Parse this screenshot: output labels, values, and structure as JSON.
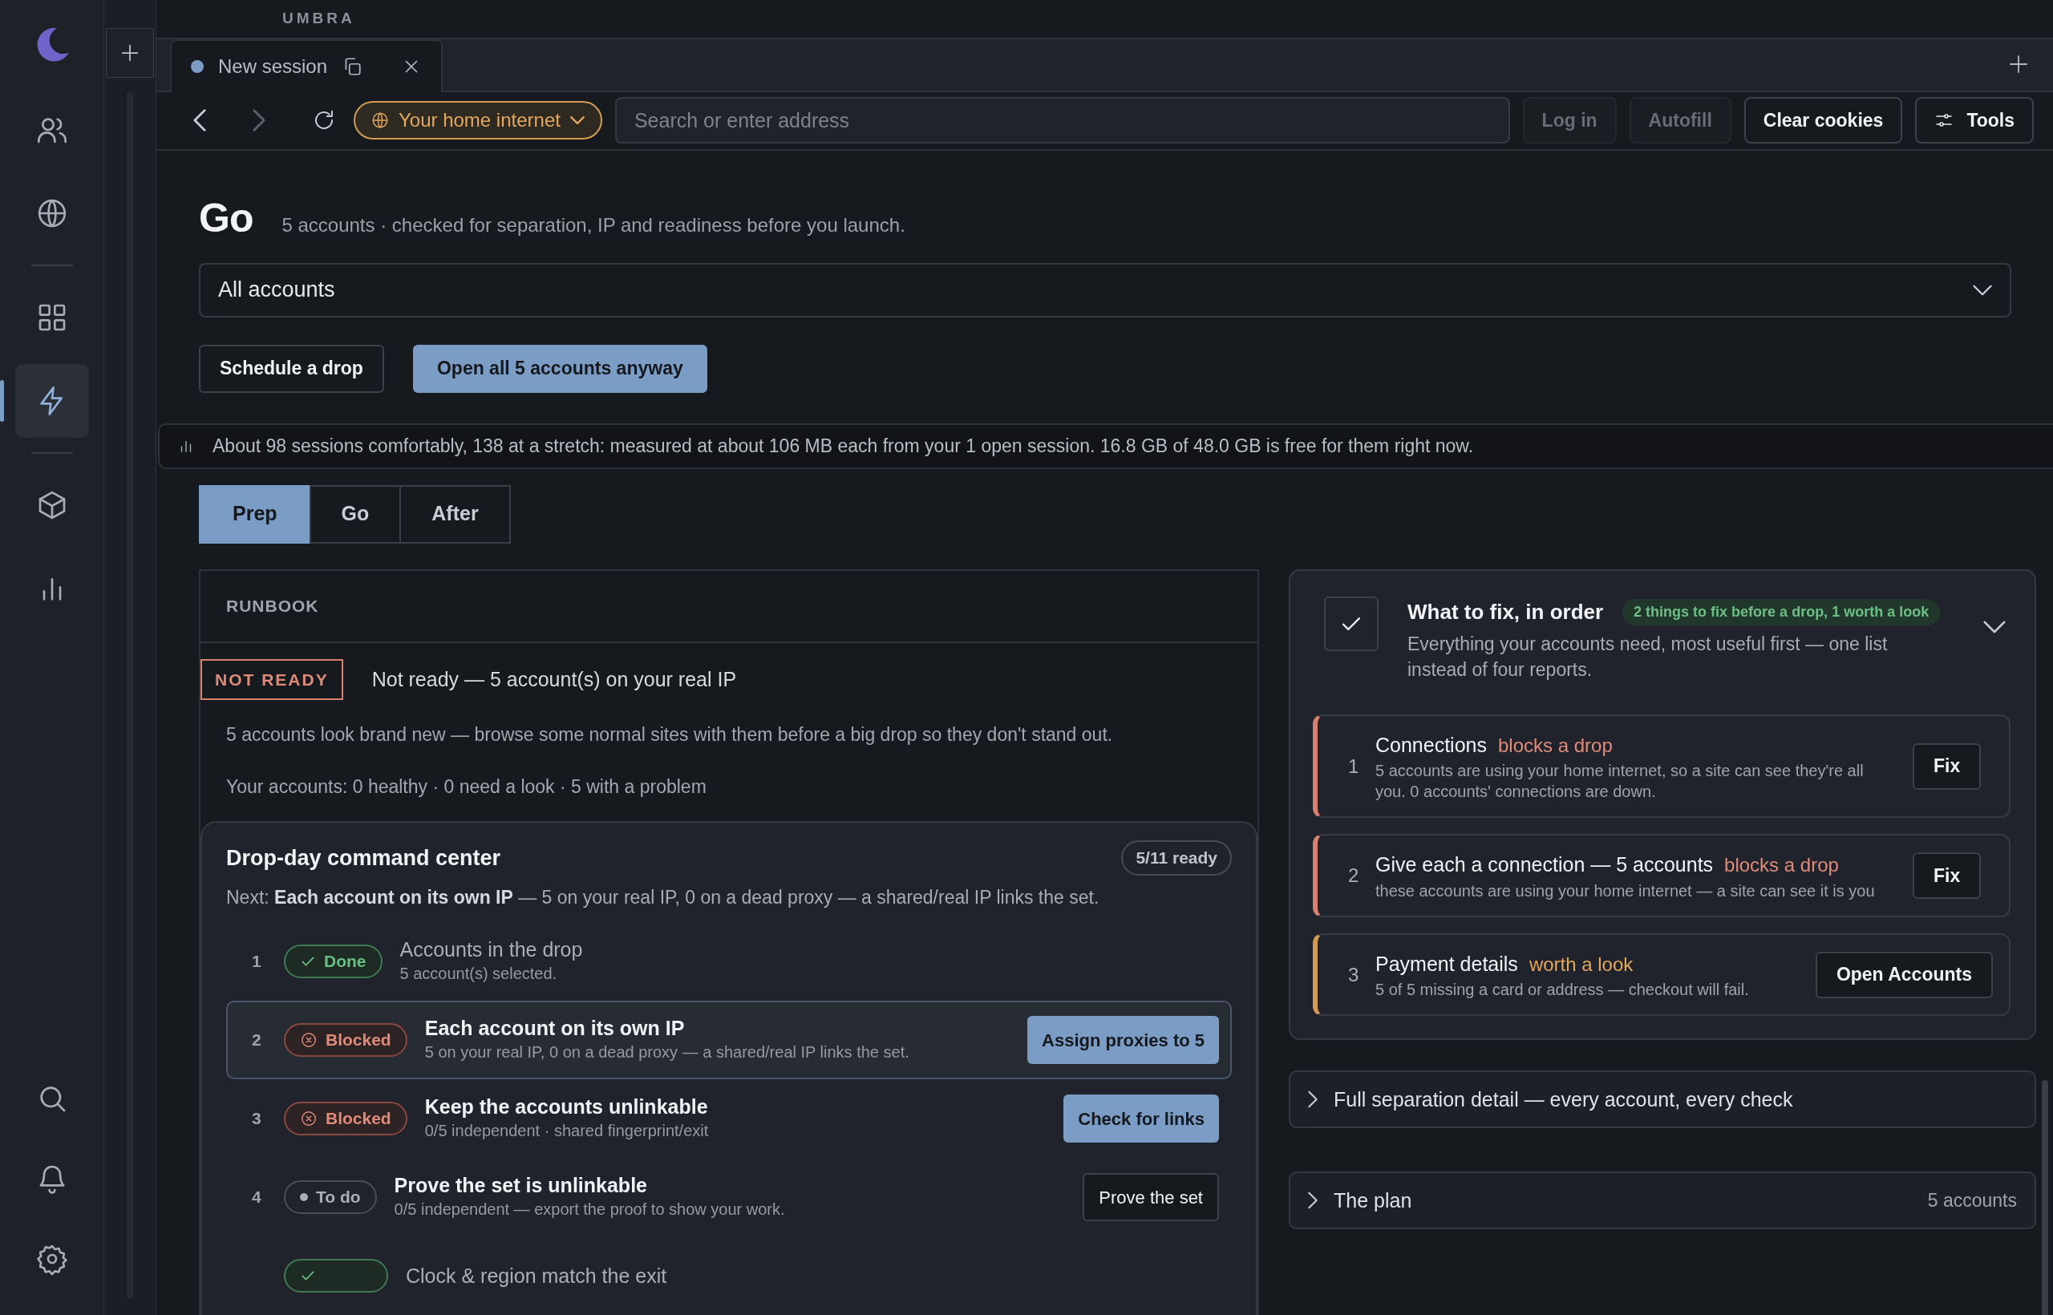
{
  "rail": {
    "items": [
      {
        "selected": false
      },
      {
        "selected": false
      },
      {
        "selected": false
      },
      {
        "selected": true
      },
      {
        "selected": false
      },
      {
        "selected": false
      }
    ]
  },
  "brand": "UMBRA",
  "tabs": [
    {
      "label": "New session",
      "selected": true,
      "color": "#7b9cc4"
    }
  ],
  "toolbar": {
    "forward_disabled": true,
    "proxy": "Your home internet",
    "address_placeholder": "Search or enter address",
    "buttons": [
      {
        "label": "Log in",
        "disabled": true
      },
      {
        "label": "Autofill",
        "disabled": true
      },
      {
        "label": "Clear cookies",
        "disabled": false
      },
      {
        "label": "Tools",
        "disabled": false,
        "kind": "tools"
      }
    ]
  },
  "page": {
    "title": "Go",
    "subtitle": "5 accounts · checked for separation, IP and readiness before you launch.",
    "filter": "All accounts",
    "actions": [
      {
        "label": "Schedule a drop",
        "primary": false
      },
      {
        "label": "Open all 5 accounts anyway",
        "primary": true
      }
    ],
    "capacity": "About 98 sessions comfortably, 138 at a stretch: measured at about 106 MB each from your 1 open session. 16.8 GB of 48.0 GB is free for them right now.",
    "phases": [
      {
        "label": "Prep",
        "selected": true
      },
      {
        "label": "Go",
        "selected": false
      },
      {
        "label": "After",
        "selected": false
      }
    ]
  },
  "runbook": {
    "heading": "RUNBOOK",
    "status_badge": "NOT READY",
    "status": "Not ready — 5 account(s) on your real IP",
    "notes": [
      "5 accounts look brand new — browse some normal sites with them before a big drop so they don't stand out.",
      "Your accounts: 0 healthy · 0 need a look · 5 with a problem"
    ]
  },
  "command_center": {
    "title": "Drop-day command center",
    "progress": "5/11 ready",
    "next": "Next: **Each account on its own IP** — 5 on your real IP, 0 on a dead proxy — a shared/real IP links the set.",
    "steps": [
      {
        "number": "1",
        "kind": "done",
        "badge": "Done",
        "title": "Accounts in the drop",
        "detail": "5 account(s) selected.",
        "highlighted": false
      },
      {
        "number": "2",
        "kind": "blocked",
        "badge": "Blocked",
        "title": "Each account on its own IP",
        "detail": "5 on your real IP, 0 on a dead proxy — a shared/real IP links the set.",
        "highlighted": true,
        "action": "Assign proxies to 5",
        "action_primary": true
      },
      {
        "number": "3",
        "kind": "blocked",
        "badge": "Blocked",
        "title": "Keep the accounts unlinkable",
        "detail": "0/5 independent · shared fingerprint/exit",
        "highlighted": false,
        "action": "Check for links",
        "action_primary": true
      },
      {
        "number": "4",
        "kind": "todo",
        "badge": "To do",
        "title": "Prove the set is unlinkable",
        "detail": "0/5 independent — export the proof to show your work.",
        "highlighted": false,
        "action": "Prove the set",
        "action_primary": false
      },
      {
        "kind": "done",
        "title": "Clock & region match the exit",
        "highlighted": false
      }
    ]
  },
  "fix_list": {
    "title": "What to fix, in order",
    "summary": "2 things to fix before a drop, 1 worth a look",
    "description": "Everything your accounts need, most useful first — one list instead of four reports.",
    "expanded": true,
    "items": [
      {
        "number": "1",
        "title": "Connections",
        "kind": "blocker",
        "tag": "blocks a drop",
        "detail": "5 accounts are using your home internet, so a site can see they're all you. 0 accounts' connections are down.",
        "action": "Fix"
      },
      {
        "number": "2",
        "title": "Give each a connection — 5 accounts",
        "kind": "blocker",
        "tag": "blocks a drop",
        "detail": "these accounts are using your home internet — a site can see it is you",
        "action": "Fix"
      },
      {
        "number": "3",
        "title": "Payment details",
        "kind": "warning",
        "tag": "worth a look",
        "detail": "5 of 5 missing a card or address — checkout will fail.",
        "action": "Open Accounts"
      }
    ]
  },
  "sections": [
    {
      "title": "Full separation detail — every account, every check",
      "expanded": false
    },
    {
      "title": "The plan",
      "expanded": false,
      "meta": "5 accounts"
    }
  ]
}
